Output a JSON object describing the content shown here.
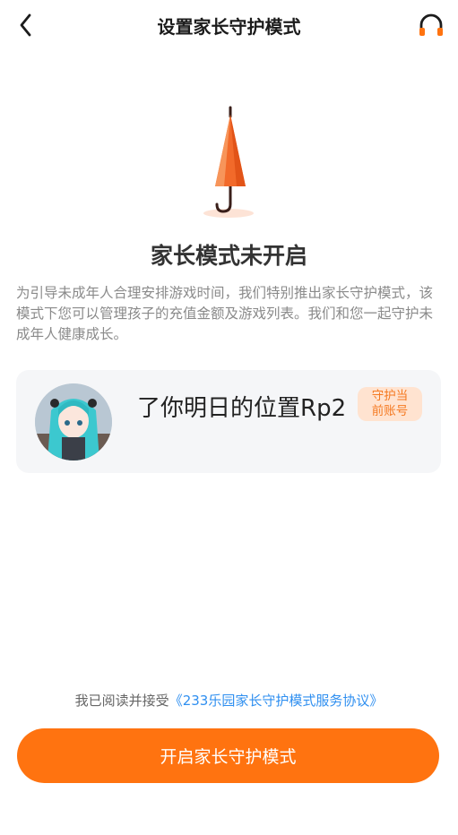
{
  "header": {
    "title": "设置家长守护模式",
    "back_icon": "chevron-left-icon",
    "support_icon": "headphones-icon"
  },
  "status": {
    "title": "家长模式未开启",
    "description": "为引导未成年人合理安排游戏时间，我们特别推出家长守护模式，该模式下您可以管理孩子的充值金额及游戏列表。我们和您一起守护未成年人健康成长。"
  },
  "account": {
    "name": "了你明日的位置Rp2",
    "badge_line1": "守护当",
    "badge_line2": "前账号"
  },
  "agreement": {
    "prefix": "我已阅读并接受",
    "link": "《233乐园家长守护模式服务协议》"
  },
  "action": {
    "label": "开启家长守护模式"
  },
  "colors": {
    "accent": "#ff7310",
    "badge_bg": "#ffe3d0",
    "link": "#2f8ff0",
    "card_bg": "#f5f6f8"
  }
}
